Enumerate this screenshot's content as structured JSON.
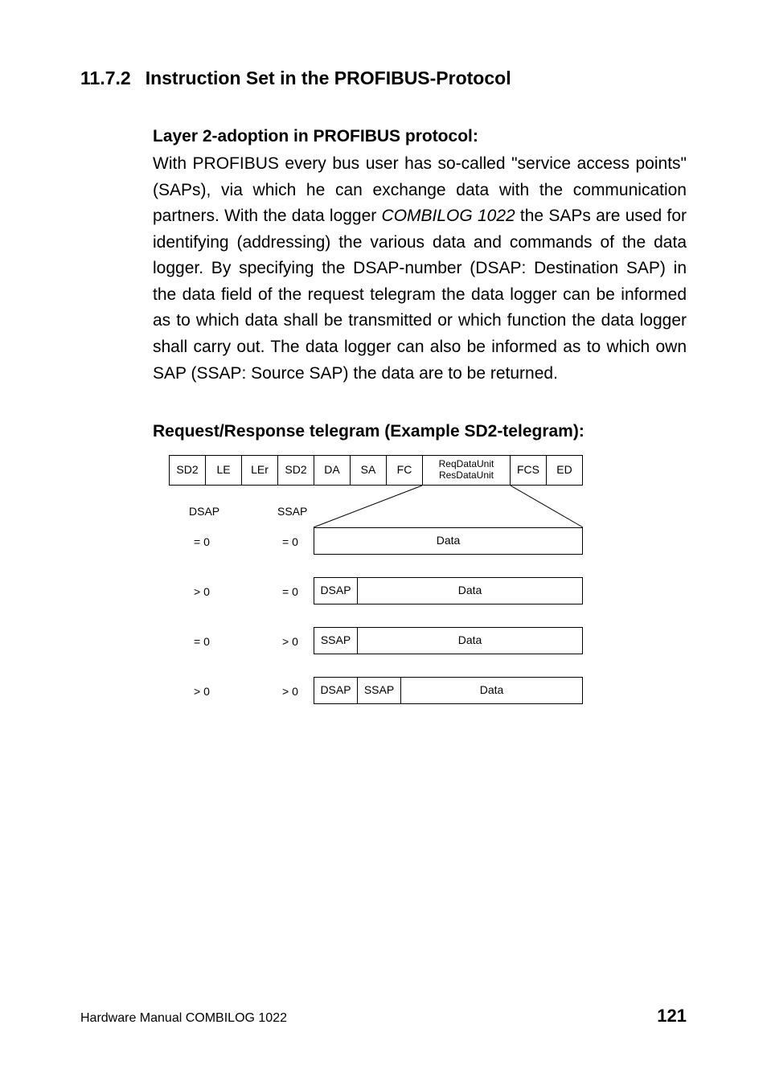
{
  "section": {
    "number": "11.7.2",
    "title": "Instruction Set in the PROFIBUS-Protocol"
  },
  "sub1": {
    "heading": "Layer 2-adoption in PROFIBUS protocol:",
    "body_before_italic": "With PROFIBUS every bus user has so-called \"service access points\" (SAPs), via which he can exchange data with the communication partners. With the data logger ",
    "italic": "COMBILOG 1022",
    "body_after_italic": " the SAPs are used for identifying (addressing) the various data and commands of the data logger. By specifying the DSAP-number (DSAP: Destination SAP) in the data field of the request telegram the data logger can be informed as to which data shall be transmitted or which function the data logger shall carry out. The data logger can also be informed as to which own SAP (SSAP: Source SAP) the data are to be returned."
  },
  "sub2": "Request/Response telegram (Example SD2-telegram):",
  "diagram": {
    "header_cells": [
      "SD2",
      "LE",
      "LEr",
      "SD2",
      "DA",
      "SA",
      "FC",
      "ReqDataUnit\nResDataUnit",
      "FCS",
      "ED"
    ],
    "left_headers": [
      "DSAP",
      "SSAP"
    ],
    "rows": [
      {
        "dsap": "= 0",
        "ssap": "= 0",
        "prefix_cells": [],
        "data_label": "Data"
      },
      {
        "dsap": "> 0",
        "ssap": "= 0",
        "prefix_cells": [
          "DSAP"
        ],
        "data_label": "Data"
      },
      {
        "dsap": "= 0",
        "ssap": "> 0",
        "prefix_cells": [
          "SSAP"
        ],
        "data_label": "Data"
      },
      {
        "dsap": "> 0",
        "ssap": "> 0",
        "prefix_cells": [
          "DSAP",
          "SSAP"
        ],
        "data_label": "Data"
      }
    ]
  },
  "footer": {
    "left": "Hardware Manual COMBILOG 1022",
    "page": "121"
  }
}
